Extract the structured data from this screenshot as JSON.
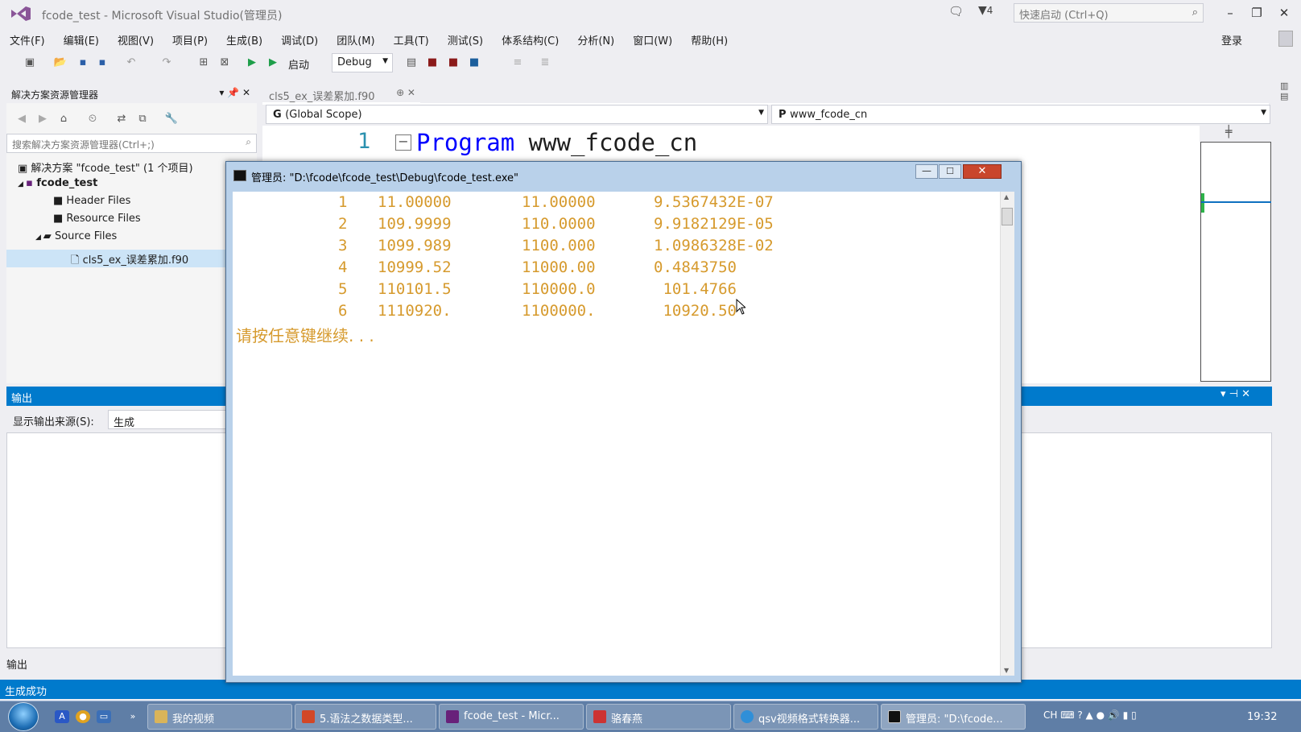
{
  "window": {
    "title": "fcode_test - Microsoft Visual Studio(管理员)"
  },
  "titlebar": {
    "notif_count": "4",
    "quick_launch_placeholder": "快速启动 (Ctrl+Q)"
  },
  "menu": [
    "文件(F)",
    "编辑(E)",
    "视图(V)",
    "项目(P)",
    "生成(B)",
    "调试(D)",
    "团队(M)",
    "工具(T)",
    "测试(S)",
    "体系结构(C)",
    "分析(N)",
    "窗口(W)",
    "帮助(H)"
  ],
  "account": {
    "login_label": "登录"
  },
  "toolbar": {
    "start_label": "启动",
    "config": "Debug"
  },
  "solution_explorer": {
    "title": "解决方案资源管理器",
    "search_placeholder": "搜索解决方案资源管理器(Ctrl+;)",
    "tree": [
      {
        "label": "解决方案 \"fcode_test\" (1 个项目)"
      },
      {
        "label": "fcode_test"
      },
      {
        "label": "Header Files"
      },
      {
        "label": "Resource Files"
      },
      {
        "label": "Source Files"
      },
      {
        "label": "cls5_ex_误差累加.f90"
      }
    ]
  },
  "editor": {
    "tab_label": "cls5_ex_误差累加.f90",
    "scope_left": "(Global Scope)",
    "scope_right": "www_fcode_cn",
    "line_number": "1",
    "keyword": "Program",
    "identifier": " www_fcode_cn"
  },
  "output": {
    "title": "输出",
    "source_label": "显示输出来源(S):",
    "source_value": "生成",
    "bottom_tab": "输出"
  },
  "status": {
    "text": "生成成功"
  },
  "console": {
    "title": "管理员:  \"D:\\fcode\\fcode_test\\Debug\\fcode_test.exe\"",
    "rows": [
      [
        "1",
        "11.00000",
        "11.00000",
        "9.5367432E-07"
      ],
      [
        "2",
        "109.9999",
        "110.0000",
        "9.9182129E-05"
      ],
      [
        "3",
        "1099.989",
        "1100.000",
        "1.0986328E-02"
      ],
      [
        "4",
        "10999.52",
        "11000.00",
        "0.4843750"
      ],
      [
        "5",
        "110101.5",
        "110000.0",
        " 101.4766"
      ],
      [
        "6",
        "1110920.",
        "1100000.",
        " 10920.50"
      ]
    ],
    "prompt": "请按任意键继续. . ."
  },
  "taskbar": {
    "tasks": [
      "我的视频",
      "5.语法之数据类型...",
      "fcode_test - Micr...",
      "骆春燕",
      "qsv视频格式转换器...",
      "管理员: \"D:\\fcode..."
    ],
    "tray_lang": "CH",
    "clock": "19:32"
  }
}
